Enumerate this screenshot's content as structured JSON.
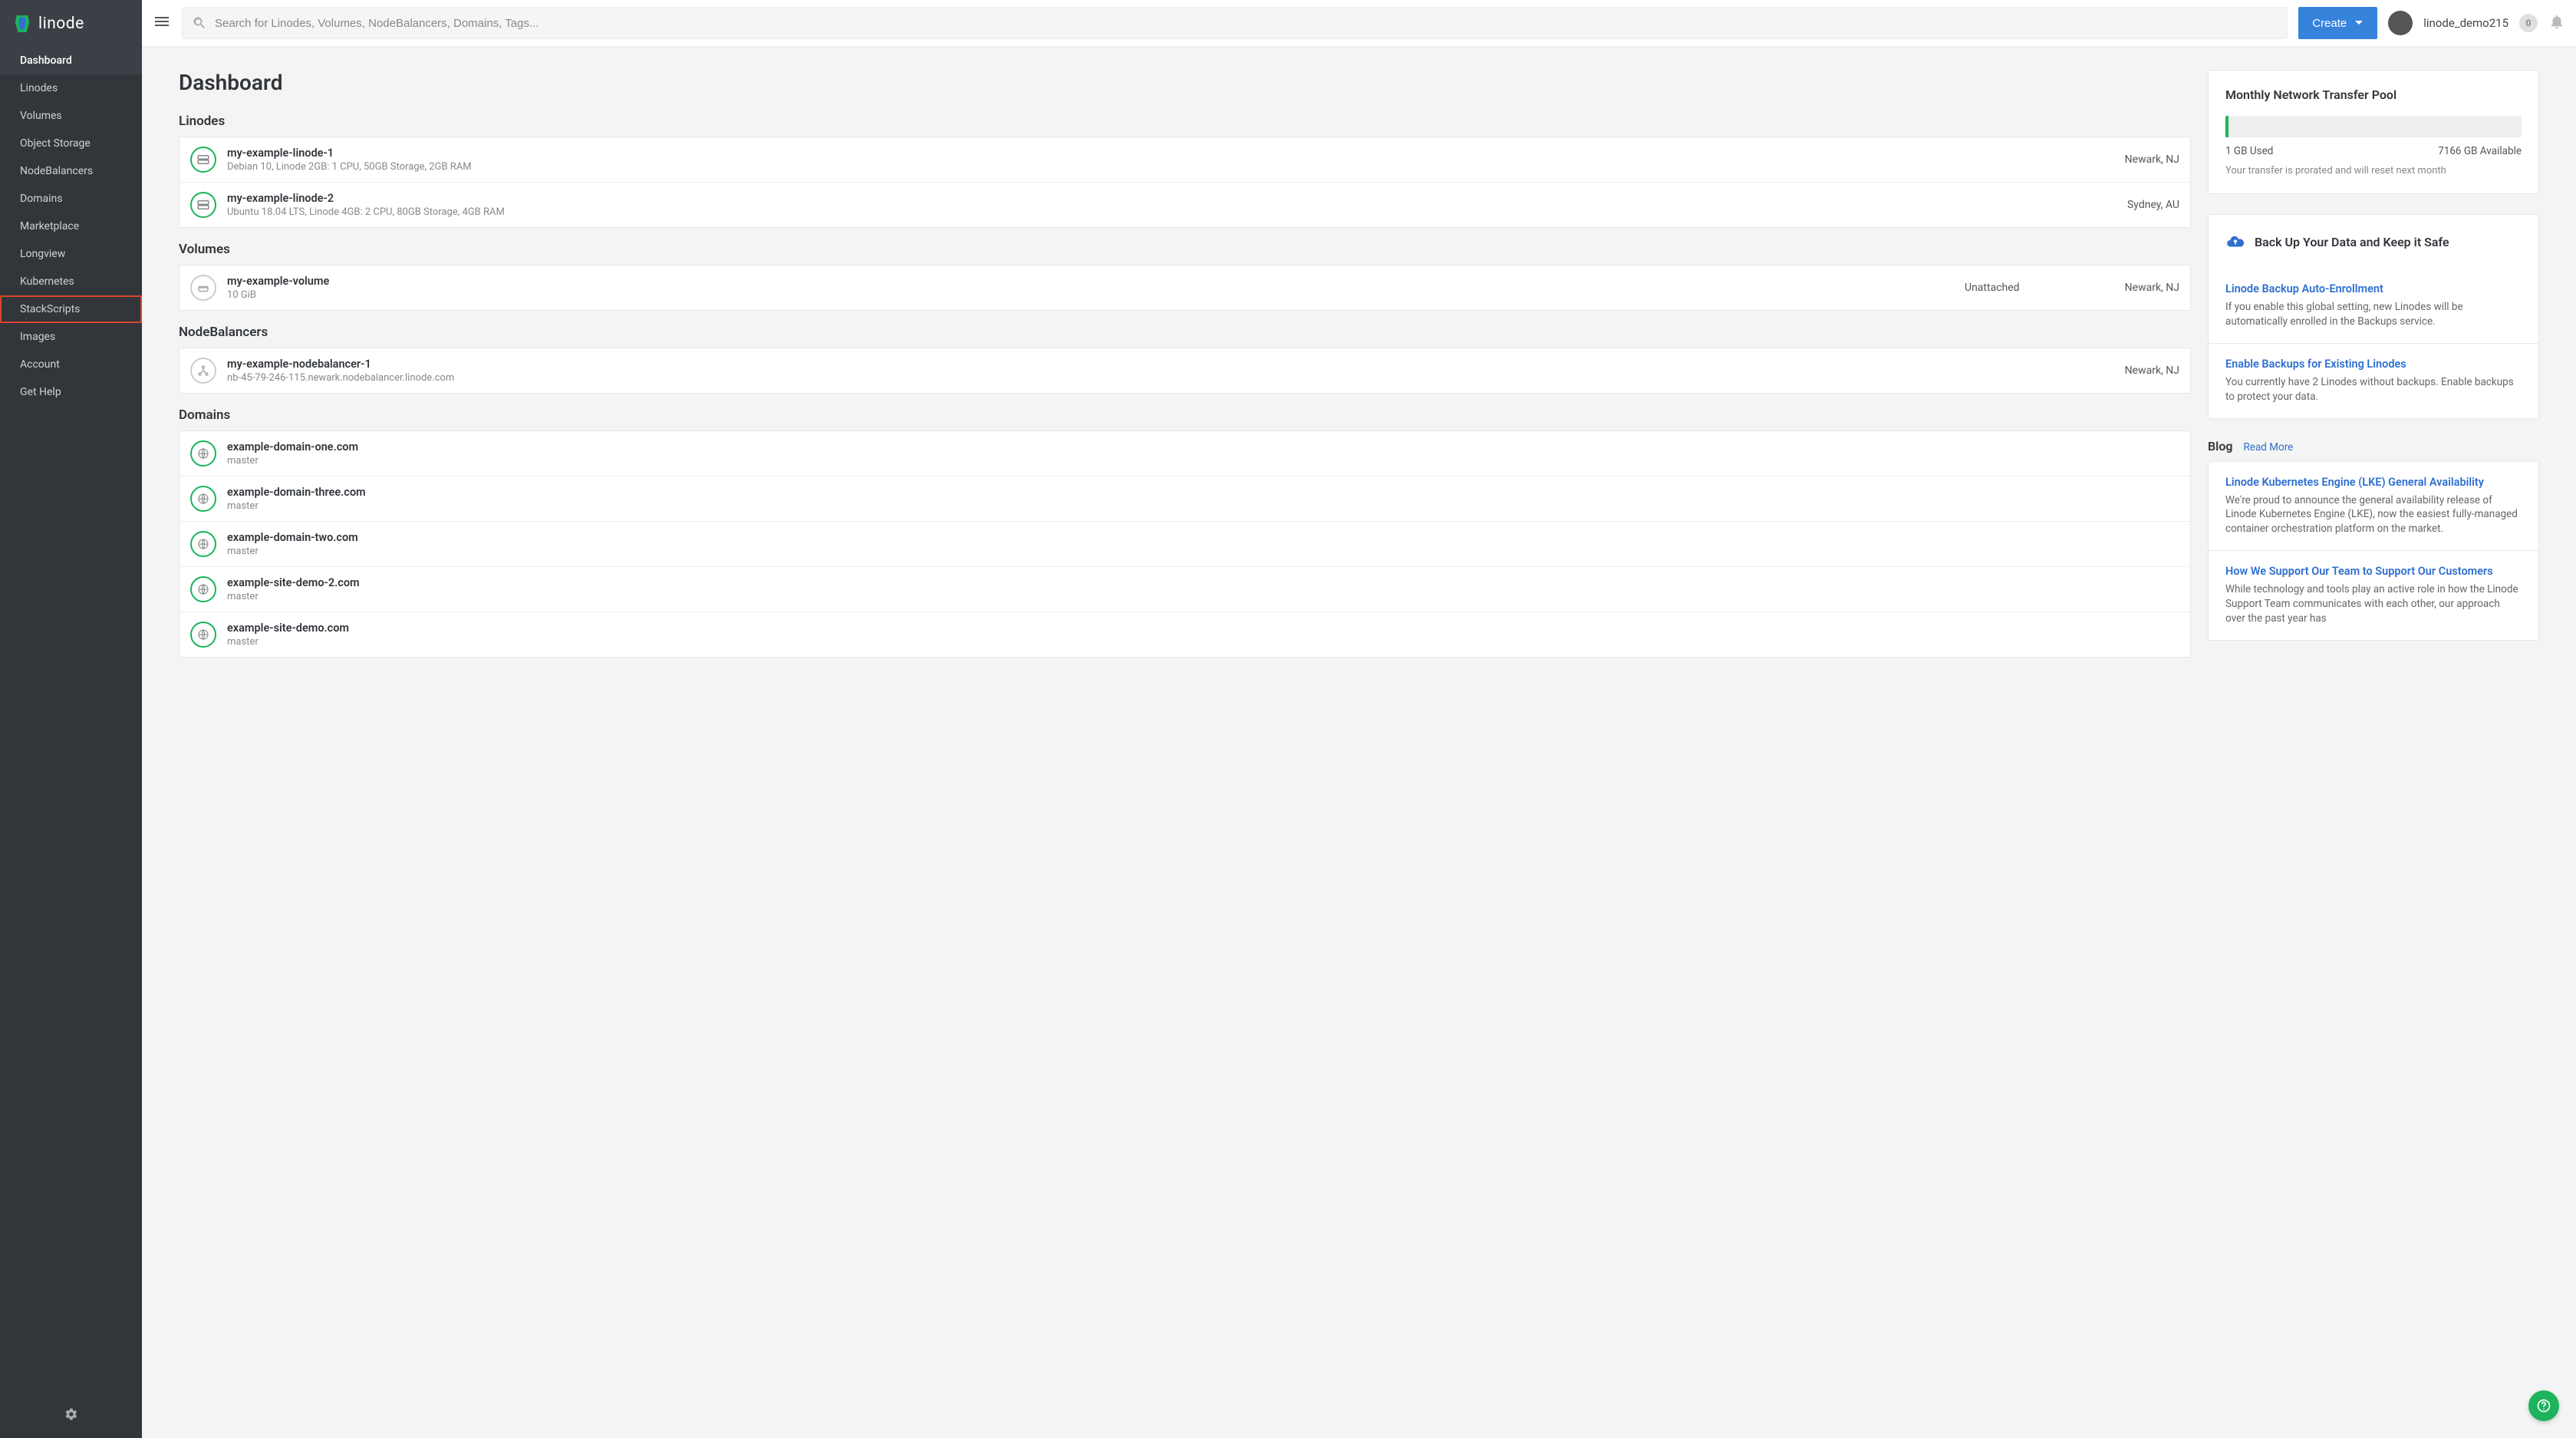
{
  "brand": {
    "name": "linode"
  },
  "sidebar": {
    "items": [
      {
        "label": "Dashboard"
      },
      {
        "label": "Linodes"
      },
      {
        "label": "Volumes"
      },
      {
        "label": "Object Storage"
      },
      {
        "label": "NodeBalancers"
      },
      {
        "label": "Domains"
      },
      {
        "label": "Marketplace"
      },
      {
        "label": "Longview"
      },
      {
        "label": "Kubernetes"
      },
      {
        "label": "StackScripts"
      },
      {
        "label": "Images"
      },
      {
        "label": "Account"
      },
      {
        "label": "Get Help"
      }
    ]
  },
  "header": {
    "search_placeholder": "Search for Linodes, Volumes, NodeBalancers, Domains, Tags...",
    "create_label": "Create",
    "username": "linode_demo215",
    "badge_count": "0"
  },
  "page": {
    "title": "Dashboard",
    "sections": {
      "linodes": {
        "title": "Linodes",
        "items": [
          {
            "name": "my-example-linode-1",
            "detail": "Debian 10, Linode 2GB: 1 CPU, 50GB Storage, 2GB RAM",
            "location": "Newark, NJ"
          },
          {
            "name": "my-example-linode-2",
            "detail": "Ubuntu 18.04 LTS, Linode 4GB: 2 CPU, 80GB Storage, 4GB RAM",
            "location": "Sydney, AU"
          }
        ]
      },
      "volumes": {
        "title": "Volumes",
        "items": [
          {
            "name": "my-example-volume",
            "detail": "10 GiB",
            "status": "Unattached",
            "location": "Newark, NJ"
          }
        ]
      },
      "nodebalancers": {
        "title": "NodeBalancers",
        "items": [
          {
            "name": "my-example-nodebalancer-1",
            "detail": "nb-45-79-246-115.newark.nodebalancer.linode.com",
            "location": "Newark, NJ"
          }
        ]
      },
      "domains": {
        "title": "Domains",
        "items": [
          {
            "name": "example-domain-one.com",
            "detail": "master"
          },
          {
            "name": "example-domain-three.com",
            "detail": "master"
          },
          {
            "name": "example-domain-two.com",
            "detail": "master"
          },
          {
            "name": "example-site-demo-2.com",
            "detail": "master"
          },
          {
            "name": "example-site-demo.com",
            "detail": "master"
          }
        ]
      }
    }
  },
  "transfer": {
    "title": "Monthly Network Transfer Pool",
    "used": "1 GB Used",
    "available": "7166 GB Available",
    "note": "Your transfer is prorated and will reset next month"
  },
  "backup": {
    "header": "Back Up Your Data and Keep it Safe",
    "cards": [
      {
        "title": "Linode Backup Auto-Enrollment",
        "desc": "If you enable this global setting, new Linodes will be automatically enrolled in the Backups service."
      },
      {
        "title": "Enable Backups for Existing Linodes",
        "desc": "You currently have 2 Linodes without backups. Enable backups to protect your data."
      }
    ]
  },
  "blog": {
    "title": "Blog",
    "read_more": "Read More",
    "posts": [
      {
        "title": "Linode Kubernetes Engine (LKE) General Availability",
        "desc": "We're proud to announce the general availability release of Linode Kubernetes Engine (LKE), now the easiest fully-managed container orchestration platform on the market."
      },
      {
        "title": "How We Support Our Team to Support Our Customers",
        "desc": "While technology and tools play an active role in how the Linode Support Team communicates with each other, our approach over the past year has"
      }
    ]
  }
}
